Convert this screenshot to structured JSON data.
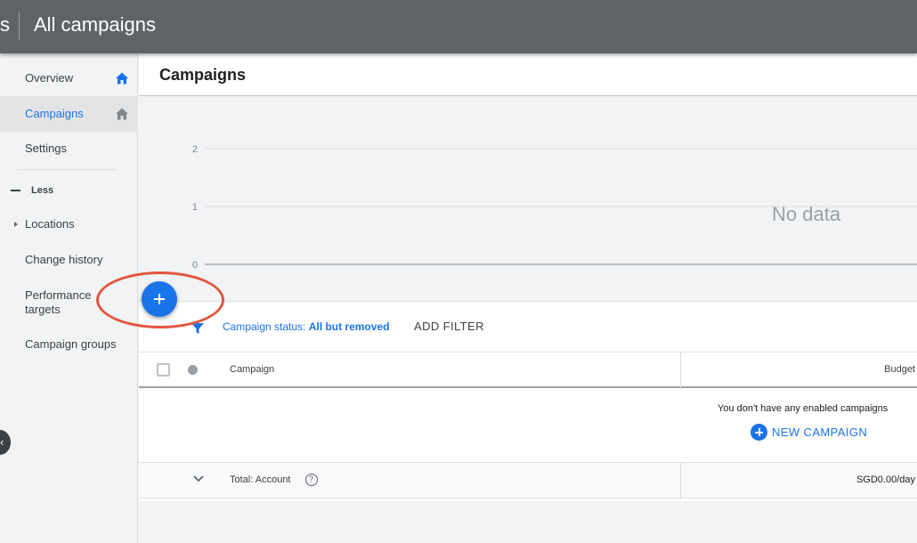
{
  "topbar": {
    "crumb_tail": "s",
    "title": "All campaigns"
  },
  "sidebar": {
    "items": [
      {
        "label": "Overview"
      },
      {
        "label": "Campaigns"
      },
      {
        "label": "Settings"
      }
    ],
    "less_label": "Less",
    "more_items": [
      {
        "label": "Locations"
      },
      {
        "label": "Change history"
      },
      {
        "label": "Performance targets"
      },
      {
        "label": "Campaign groups"
      }
    ],
    "collapse_glyph": "‹"
  },
  "main": {
    "title": "Campaigns",
    "chart": {
      "no_data_label": "No data"
    },
    "filter": {
      "status_label": "Campaign status:",
      "status_value": "All but removed",
      "add_filter_label": "ADD FILTER"
    },
    "table": {
      "columns": [
        "Campaign",
        "Budget"
      ],
      "empty_message": "You don't have any enabled campaigns",
      "new_campaign_label": "NEW CAMPAIGN",
      "total_label": "Total: Account",
      "total_budget": "SGD0.00/day",
      "help_glyph": "?"
    }
  },
  "chart_data": {
    "type": "line",
    "y_ticks": [
      "2",
      "1",
      "0"
    ],
    "ylim": [
      0,
      2
    ],
    "series": [],
    "grid": true
  },
  "colors": {
    "accent": "#1a73e8",
    "topbar": "#5f6368",
    "highlight": "#e2553f"
  },
  "icons": {
    "home": "home-icon",
    "filter": "filter-icon",
    "add": "plus-icon",
    "expand": "chevron-down-icon",
    "help": "help-icon"
  }
}
